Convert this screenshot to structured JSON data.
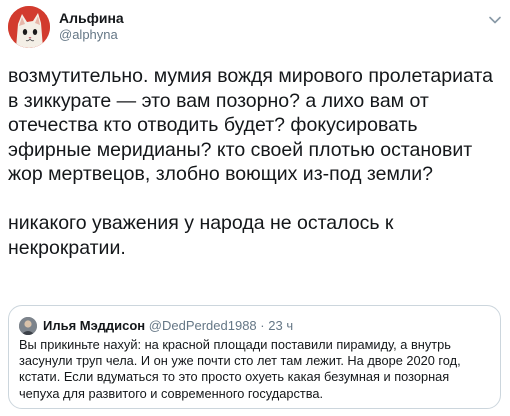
{
  "author": {
    "name": "Альфина",
    "handle": "@alphyna",
    "avatar_color": "#d23b2e"
  },
  "tweet": {
    "paragraph_1": "возмутительно. мумия вождя мирового пролетариата в зиккурате — это вам позорно? а лихо вам от отечества кто отводить будет? фокусировать эфирные меридианы? кто своей плотью остановит жор мертвецов, злобно воющих из-под земли?",
    "paragraph_2": "никакого уважения у народа не осталось к некрократии."
  },
  "quote": {
    "name": "Илья Мэддисон",
    "handle": "@DedPerded1988",
    "separator": "·",
    "time": "23 ч",
    "text": "Вы прикиньте нахуй: на красной площади поставили пирамиду, а внутрь засунули труп чела. И он уже почти сто лет там лежит. На дворе 2020 год, кстати. Если вдуматься то это просто охуеть какая безумная и позорная чепуха для развитого и современного государства."
  },
  "icons": {
    "more_menu": "chevron-down-icon"
  },
  "colors": {
    "text_primary": "#14171a",
    "text_secondary": "#657786",
    "border": "#ccd6dd"
  }
}
